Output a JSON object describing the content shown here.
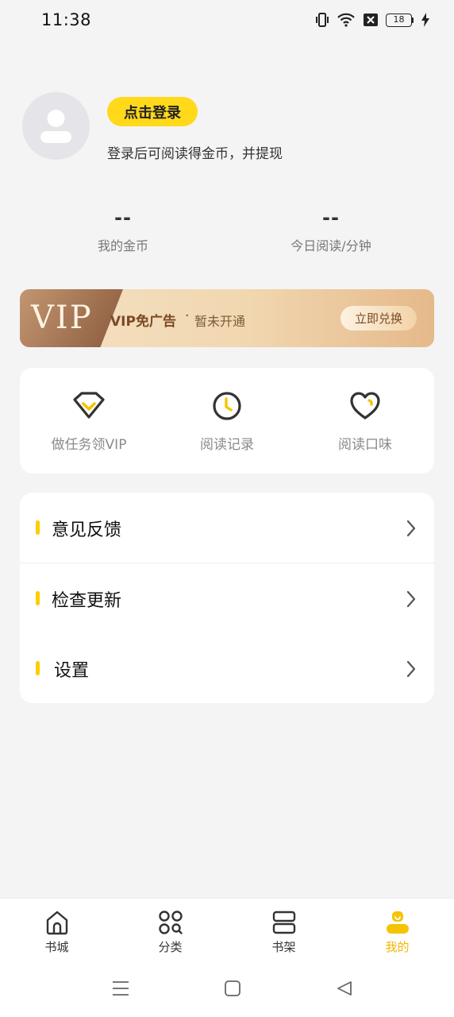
{
  "status_bar": {
    "time": "11:38",
    "battery_level": "18",
    "icons": [
      "vibrate-icon",
      "wifi-icon",
      "sim-off-icon",
      "battery-icon",
      "charging-icon"
    ]
  },
  "profile": {
    "login_button_label": "点击登录",
    "login_hint": "登录后可阅读得金币，并提现"
  },
  "stats": [
    {
      "value": "--",
      "label": "我的金币"
    },
    {
      "value": "--",
      "label": "今日阅读/分钟"
    }
  ],
  "vip": {
    "logo_text": "VIP",
    "title": "VIP免广告",
    "separator": "·",
    "status": "暂未开通",
    "button_label": "立即兑换"
  },
  "quick_actions": [
    {
      "label": "做任务领VIP",
      "icon": "diamond-icon"
    },
    {
      "label": "阅读记录",
      "icon": "clock-icon"
    },
    {
      "label": "阅读口味",
      "icon": "heart-icon"
    }
  ],
  "menu": [
    {
      "label": "意见反馈"
    },
    {
      "label": "检查更新"
    },
    {
      "label": "设置"
    }
  ],
  "bottom_nav": [
    {
      "label": "书城",
      "icon": "home-icon",
      "active": false
    },
    {
      "label": "分类",
      "icon": "category-icon",
      "active": false
    },
    {
      "label": "书架",
      "icon": "bookshelf-icon",
      "active": false
    },
    {
      "label": "我的",
      "icon": "profile-icon",
      "active": true
    }
  ],
  "colors": {
    "accent": "#ffd91a",
    "active_tab": "#f2b600",
    "vip_text": "#7a4a26",
    "background": "#f4f4f4"
  }
}
